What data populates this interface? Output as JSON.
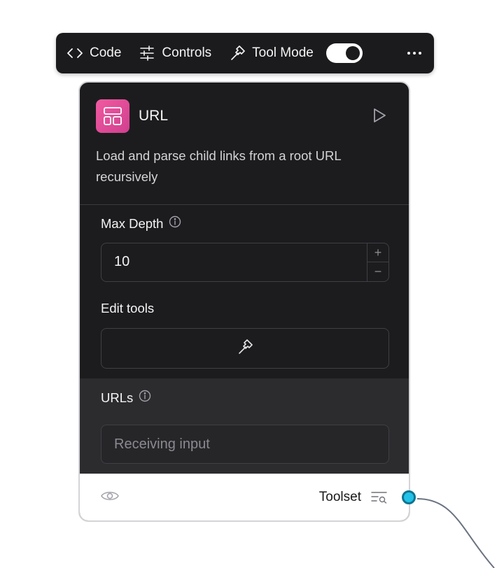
{
  "toolbar": {
    "code_label": "Code",
    "controls_label": "Controls",
    "tool_mode_label": "Tool Mode",
    "tool_mode_enabled": true
  },
  "node": {
    "title": "URL",
    "description": "Load and parse child links from a root URL recursively",
    "icon": "layout-icon",
    "icon_color": "#e8539c",
    "fields": {
      "max_depth": {
        "label": "Max Depth",
        "value": "10",
        "increment": "+",
        "decrement": "−"
      },
      "edit_tools": {
        "label": "Edit tools",
        "icon": "hammer-icon"
      },
      "urls": {
        "label": "URLs",
        "placeholder": "Receiving input"
      }
    },
    "footer": {
      "output_label": "Toolset",
      "handle_color": "#22c1e8"
    }
  }
}
